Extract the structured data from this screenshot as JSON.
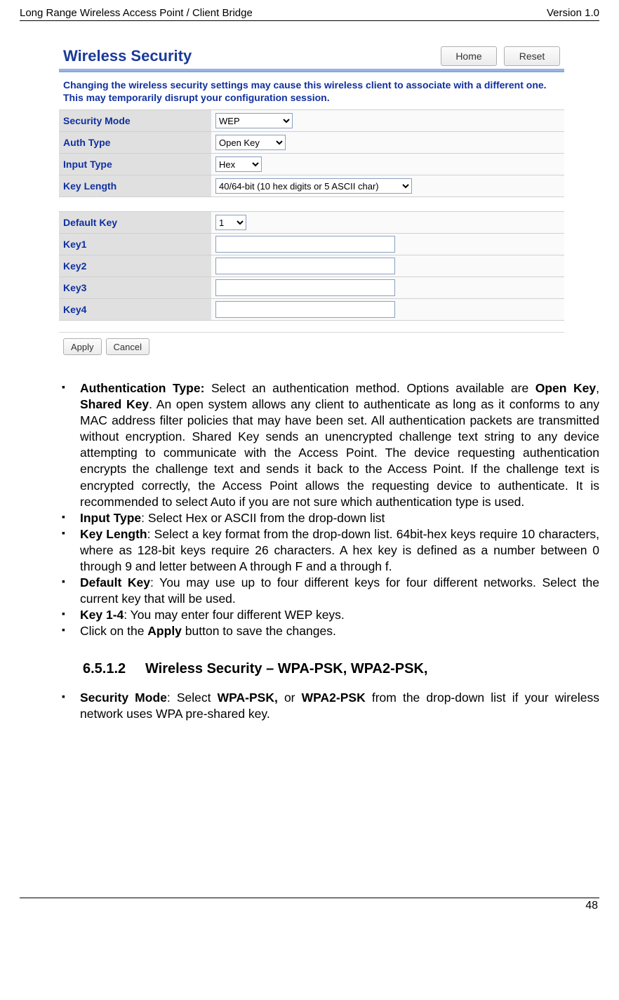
{
  "header": {
    "left": "Long Range Wireless Access Point / Client Bridge",
    "right": "Version 1.0"
  },
  "screenshot": {
    "title": "Wireless Security",
    "home_btn": "Home",
    "reset_btn": "Reset",
    "warning": "Changing the wireless security settings may cause this wireless client to associate with a different one. This may temporarily disrupt your configuration session.",
    "rows": {
      "security_mode": {
        "label": "Security Mode",
        "value": "WEP"
      },
      "auth_type": {
        "label": "Auth Type",
        "value": "Open Key"
      },
      "input_type": {
        "label": "Input Type",
        "value": "Hex"
      },
      "key_length": {
        "label": "Key Length",
        "value": "40/64-bit (10 hex digits or 5 ASCII char)"
      },
      "default_key": {
        "label": "Default Key",
        "value": "1"
      },
      "key1": {
        "label": "Key1",
        "value": ""
      },
      "key2": {
        "label": "Key2",
        "value": ""
      },
      "key3": {
        "label": "Key3",
        "value": ""
      },
      "key4": {
        "label": "Key4",
        "value": ""
      }
    },
    "apply": "Apply",
    "cancel": "Cancel"
  },
  "doc": {
    "b1_lead": "Authentication Type:",
    "b1_rest": " Select an authentication method. Options available are ",
    "b1_bold1": "Open Key",
    "b1_mid": ", ",
    "b1_bold2": "Shared Key",
    "b1_tail": ". An open system allows any client to authenticate as long as it conforms to any MAC address filter policies that may have been set. All authentication packets are transmitted without encryption. Shared Key sends an unencrypted challenge text string to any device attempting to communicate with the Access Point. The device requesting authentication encrypts the challenge text and sends it back to the Access Point. If the challenge text is encrypted correctly, the Access Point allows the requesting device to authenticate. It is recommended to select Auto if you are not sure which authentication type is used.",
    "b2_lead": "Input Type",
    "b2_rest": ": Select Hex or ASCII from the drop-down list",
    "b3_lead": "Key Length",
    "b3_rest": ": Select a key format from the drop-down list. 64bit-hex keys require 10 characters, where as 128-bit keys require 26 characters. A hex key is defined as a number between 0 through 9 and letter between A through F and a through f.",
    "b4_lead": "Default Key",
    "b4_rest": ": You may use up to four different keys for four different networks. Select the current key that will be used.",
    "b5_lead": "Key 1-4",
    "b5_rest": ": You may enter four different WEP keys.",
    "b6_pre": "Click on the ",
    "b6_bold": "Apply",
    "b6_post": " button to save the changes.",
    "subheading": "6.5.1.2     Wireless Security – WPA-PSK, WPA2-PSK,",
    "b7_lead": "Security Mode",
    "b7_mid1": ": Select ",
    "b7_bold1": "WPA-PSK,",
    "b7_mid2": " or ",
    "b7_bold2": "WPA2-PSK",
    "b7_tail": " from the drop-down list if your wireless network uses WPA pre-shared key."
  },
  "footer": {
    "page": "48"
  }
}
